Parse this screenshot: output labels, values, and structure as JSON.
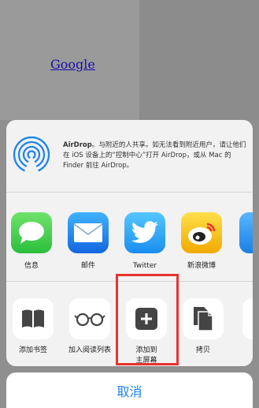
{
  "background": {
    "link_text": "Google"
  },
  "airdrop": {
    "icon": "airdrop-icon",
    "title": "AirDrop",
    "description": "。与附近的人共享。如无法看到附近用户，请让他们在 iOS 设备上的“控制中心”打开 AirDrop，或从 Mac 的 Finder 前往 AirDrop。"
  },
  "share_apps": [
    {
      "label": "信息",
      "icon": "messages-icon",
      "color": "#34c759"
    },
    {
      "label": "邮件",
      "icon": "mail-icon",
      "color": "#1e88f5"
    },
    {
      "label": "Twitter",
      "icon": "twitter-bird-icon",
      "color": "#1da1f2"
    },
    {
      "label": "新浪微博",
      "icon": "weibo-icon",
      "color": "#f4b400"
    }
  ],
  "actions": [
    {
      "label": "添加书签",
      "icon": "book-icon"
    },
    {
      "label": "加入阅读列表",
      "icon": "glasses-icon"
    },
    {
      "label": "添加到\n主屏幕",
      "icon": "add-square-icon"
    },
    {
      "label": "拷贝",
      "icon": "copy-icon"
    }
  ],
  "cancel_label": "取消",
  "colors": {
    "accent": "#1a82f0",
    "highlight": "#e8332f"
  }
}
